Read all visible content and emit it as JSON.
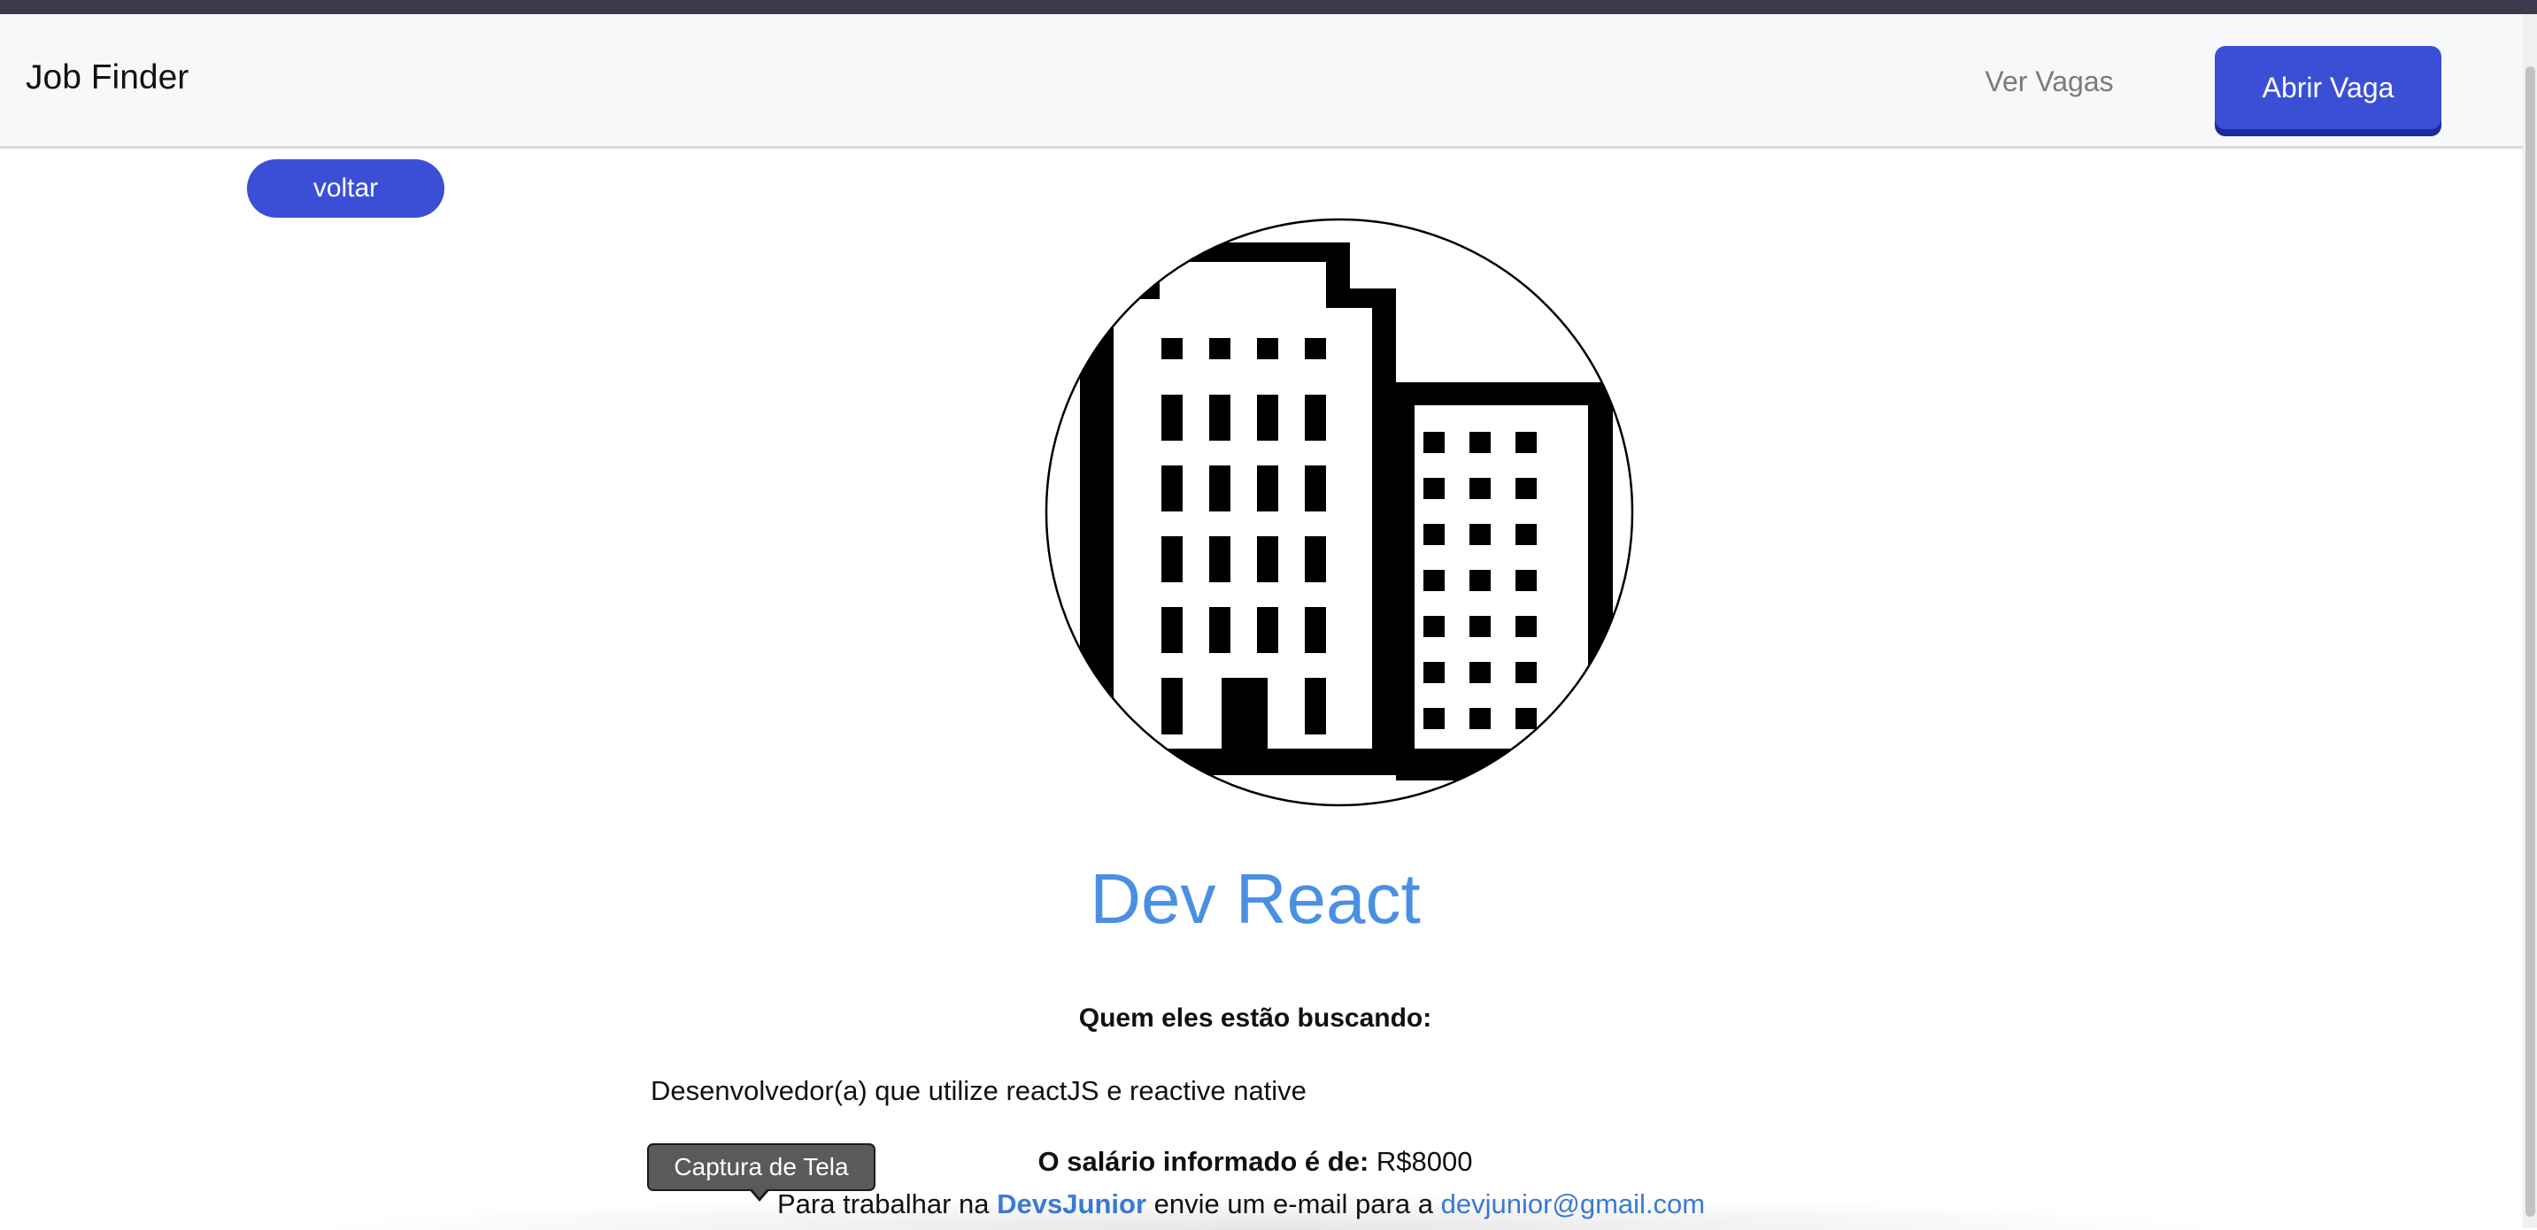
{
  "navbar": {
    "brand": "Job Finder",
    "links": [
      {
        "label": "Ver Vagas"
      }
    ],
    "cta_label": "Abrir Vaga"
  },
  "page": {
    "back_label": "voltar",
    "company_logo_icon": "office-building-icon",
    "job_title": "Dev React",
    "looking_for_heading": "Quem eles estão buscando:",
    "description": "Desenvolvedor(a) que utilize reactJS e reactive native",
    "salary_label": "O salário informado é de:",
    "salary_value": "R$8000",
    "contact_prefix": "Para trabalhar na",
    "company_name": "DevsJunior",
    "contact_middle": "envie um e-mail para a",
    "contact_email": "devjunior@gmail.com"
  },
  "tooltip": {
    "label": "Captura de Tela"
  },
  "colors": {
    "primary": "#3b4fd6",
    "title": "#4a90e2",
    "link": "#3b7dd8"
  }
}
